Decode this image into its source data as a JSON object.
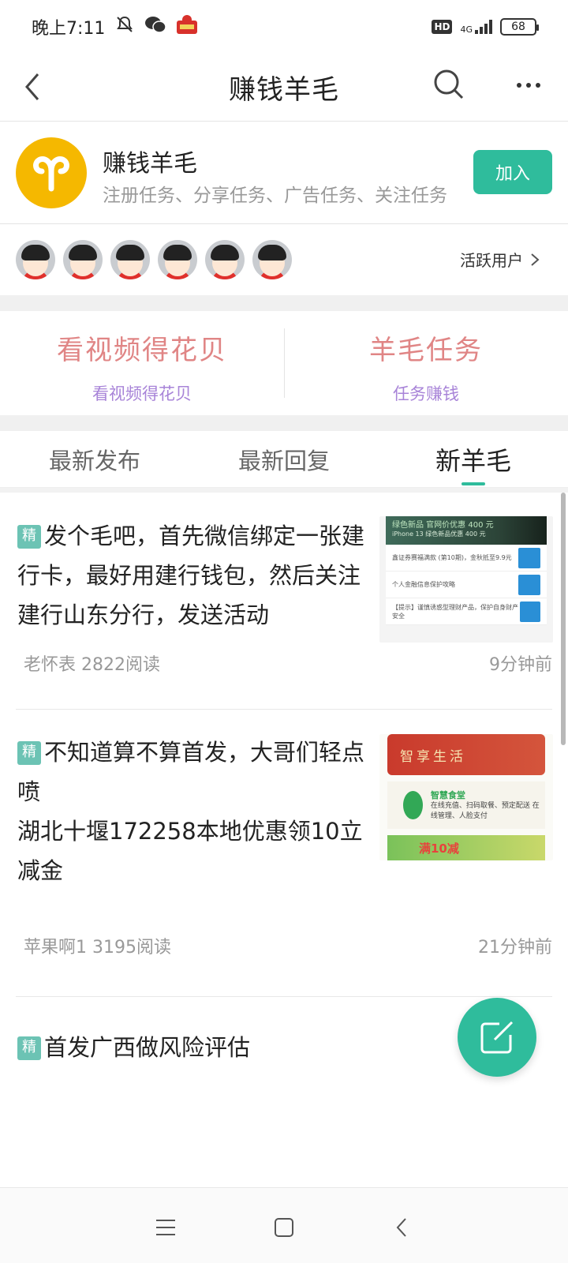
{
  "status_bar": {
    "time": "晚上7:11",
    "hd": "HD",
    "network": "4G",
    "battery": "68"
  },
  "header": {
    "title": "赚钱羊毛"
  },
  "group": {
    "name": "赚钱羊毛",
    "description": "注册任务、分享任务、广告任务、关注任务",
    "join_label": "加入",
    "accent_color": "#2fbc9c",
    "avatar_color": "#f5b800"
  },
  "members": {
    "count_shown": 6,
    "active_users_label": "活跃用户"
  },
  "features": [
    {
      "title": "看视频得花贝",
      "subtitle": "看视频得花贝"
    },
    {
      "title": "羊毛任务",
      "subtitle": "任务赚钱"
    }
  ],
  "tabs": [
    {
      "label": "最新发布",
      "active": false
    },
    {
      "label": "最新回复",
      "active": false
    },
    {
      "label": "新羊毛",
      "active": true
    }
  ],
  "posts": [
    {
      "badge": "精",
      "title": "发个毛吧，首先微信绑定一张建行卡，最好用建行钱包，然后关注建行山东分行，发送活动",
      "author": "老怀表",
      "reads": "2822阅读",
      "time": "9分钟前",
      "thumb": {
        "banner_text": "绿色新品 官网价优惠 400 元",
        "banner_sub": "iPhone 13 绿色新品优惠 400 元",
        "rows": [
          "鑫证券赛福满款 (第10期)，金秋抵至9.9元",
          "个人金融信息保护攻略",
          "【提示】谨慎诱惑型理财产品，保护自身财产安全"
        ]
      }
    },
    {
      "badge": "精",
      "title_line1": "不知道算不算首发，大哥们轻点喷",
      "title_line2": "湖北十堰172258本地优惠领10立减金",
      "author": "苹果啊1",
      "reads": "3195阅读",
      "time": "21分钟前",
      "thumb": {
        "top_text": "智享生活",
        "mid_title": "智慧食堂",
        "mid_text": "在线充值、扫码取餐、预定配送 在线管理、人脸支付",
        "bottom_text": "满10减"
      }
    },
    {
      "badge": "精",
      "title": "首发广西做风险评估"
    }
  ]
}
